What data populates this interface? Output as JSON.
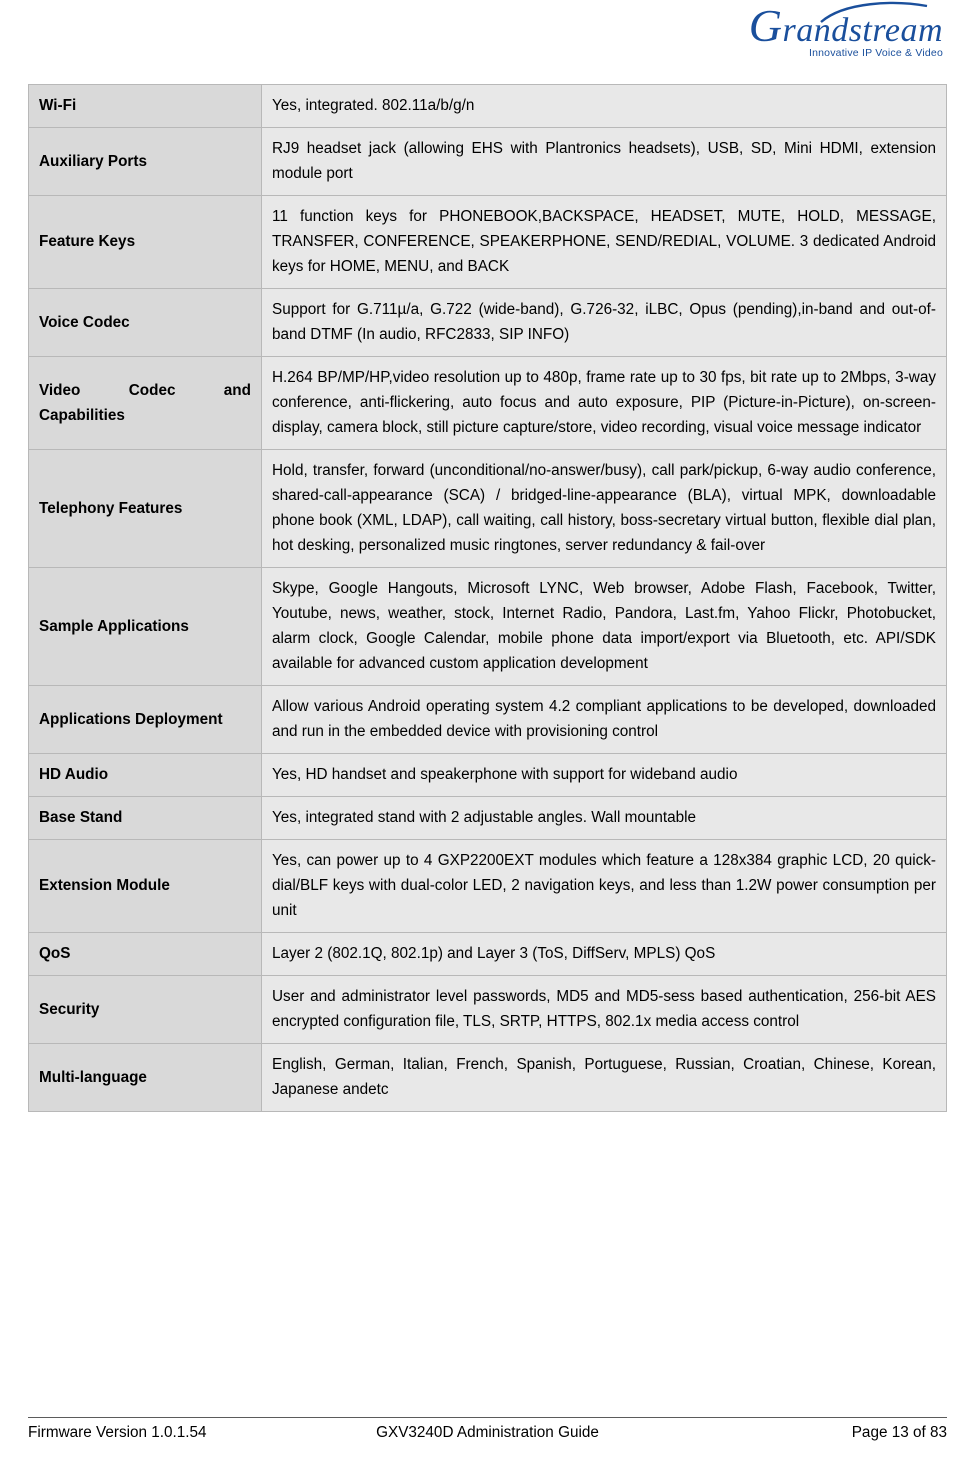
{
  "header": {
    "logo_main": "randstream",
    "logo_initial": "G",
    "logo_tagline": "Innovative IP Voice & Video"
  },
  "table": {
    "rows": [
      {
        "label": "Wi-Fi",
        "value": "Yes, integrated. 802.11a/b/g/n",
        "single_line": true
      },
      {
        "label": "Auxiliary Ports",
        "value": "RJ9 headset jack (allowing EHS with Plantronics headsets), USB, SD, Mini HDMI, extension module port",
        "single_line": false
      },
      {
        "label": "Feature Keys",
        "value": "11 function keys for PHONEBOOK,BACKSPACE, HEADSET, MUTE, HOLD, MESSAGE, TRANSFER, CONFERENCE, SPEAKERPHONE, SEND/REDIAL, VOLUME. 3 dedicated Android keys for HOME, MENU, and BACK",
        "single_line": false
      },
      {
        "label": "Voice Codec",
        "value": "Support for G.711µ/a, G.722 (wide-band), G.726-32, iLBC, Opus (pending),in-band and out-of-band DTMF (In audio, RFC2833, SIP INFO)",
        "single_line": false
      },
      {
        "label": "Video Codec and Capabilities",
        "value": "H.264 BP/MP/HP,video resolution up to 480p, frame rate up to 30 fps, bit rate up to 2Mbps, 3-way conference, anti-flickering, auto focus and auto exposure, PIP (Picture-in-Picture), on-screen-display, camera block, still picture capture/store, video recording, visual voice message indicator",
        "single_line": false
      },
      {
        "label": "Telephony Features",
        "value": "Hold, transfer, forward (unconditional/no-answer/busy), call park/pickup, 6-way audio conference, shared-call-appearance (SCA) / bridged-line-appearance (BLA), virtual MPK, downloadable phone book (XML, LDAP), call waiting, call history, boss-secretary virtual button, flexible dial plan, hot desking, personalized music ringtones, server redundancy & fail-over",
        "single_line": false
      },
      {
        "label": "Sample Applications",
        "value": "Skype, Google Hangouts, Microsoft LYNC, Web browser, Adobe Flash, Facebook, Twitter, Youtube, news, weather, stock, Internet Radio, Pandora, Last.fm, Yahoo Flickr, Photobucket, alarm clock, Google Calendar, mobile phone data import/export via Bluetooth, etc. API/SDK available for advanced custom application development",
        "single_line": false
      },
      {
        "label": "Applications Deployment",
        "value": "Allow various Android operating system 4.2 compliant applications to be developed, downloaded and run in the embedded device with provisioning control",
        "single_line": false
      },
      {
        "label": "HD Audio",
        "value": "Yes, HD handset and speakerphone with support for wideband audio",
        "single_line": true
      },
      {
        "label": "Base Stand",
        "value": "Yes, integrated stand with 2 adjustable angles. Wall mountable",
        "single_line": true
      },
      {
        "label": "Extension Module",
        "value": "Yes, can power up to 4 GXP2200EXT modules which feature a 128x384 graphic LCD, 20 quick-dial/BLF keys with dual-color LED, 2 navigation keys, and less than 1.2W power consumption per unit",
        "single_line": false
      },
      {
        "label": "QoS",
        "value": "Layer 2 (802.1Q, 802.1p) and Layer 3 (ToS, DiffServ, MPLS) QoS",
        "single_line": true
      },
      {
        "label": "Security",
        "value": "User and administrator level passwords, MD5 and MD5-sess based authentication, 256-bit AES encrypted configuration file, TLS, SRTP, HTTPS, 802.1x media access control",
        "single_line": false
      },
      {
        "label": "Multi-language",
        "value": "English, German, Italian, French, Spanish, Portuguese, Russian, Croatian, Chinese, Korean, Japanese andetc",
        "single_line": false
      }
    ]
  },
  "footer": {
    "left": "Firmware Version 1.0.1.54",
    "center": "GXV3240D Administration Guide",
    "right": "Page 13 of 83"
  }
}
